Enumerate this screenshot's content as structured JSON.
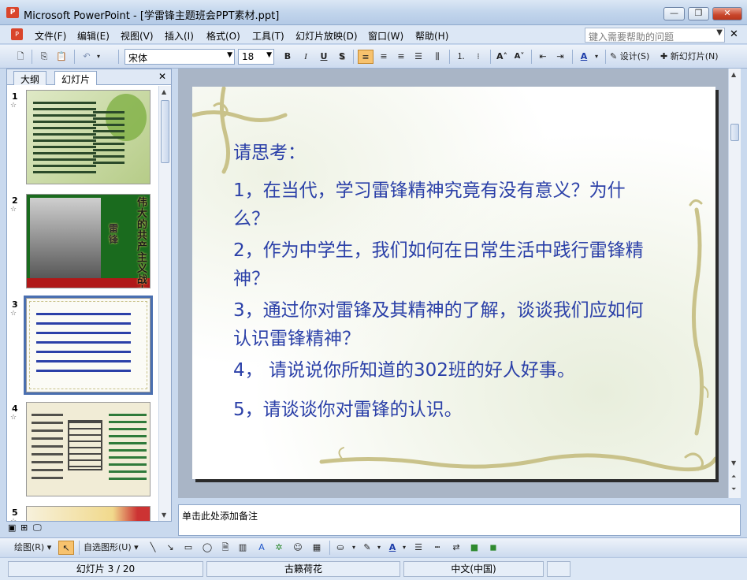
{
  "window": {
    "title": "Microsoft PowerPoint - [学雷锋主题班会PPT素材.ppt]",
    "app_icon": "P"
  },
  "menubar": {
    "items": [
      "文件(F)",
      "编辑(E)",
      "视图(V)",
      "插入(I)",
      "格式(O)",
      "工具(T)",
      "幻灯片放映(D)",
      "窗口(W)",
      "帮助(H)"
    ],
    "help_placeholder": "键入需要帮助的问题"
  },
  "toolbar": {
    "font_name": "宋体",
    "font_size": "18",
    "bold": "B",
    "italic": "I",
    "underline": "U",
    "shadow": "S",
    "design_label": "设计(S)",
    "new_slide_label": "新幻灯片(N)"
  },
  "outline_pane": {
    "tabs": [
      "大纲",
      "幻灯片"
    ],
    "selected_tab": "幻灯片",
    "slides": [
      {
        "num": "1"
      },
      {
        "num": "2",
        "caption": "伟大的共产主义战士",
        "subcaption": "雷锋"
      },
      {
        "num": "3"
      },
      {
        "num": "4"
      },
      {
        "num": "5"
      }
    ]
  },
  "slide": {
    "lines": [
      "请思考：",
      "1，在当代，学习雷锋精神究竟有没有意义？为什么？",
      "2，作为中学生，我们如何在日常生活中践行雷锋精神？",
      "3，通过你对雷锋及其精神的了解，谈谈我们应如何认识雷锋精神？",
      "4， 请说说你所知道的302班的好人好事。",
      "5，请谈谈你对雷锋的认识。"
    ],
    "text_color": "#2b40a8",
    "frame_color": "#c9c28a"
  },
  "notes": {
    "placeholder": "单击此处添加备注"
  },
  "drawbar": {
    "draw_label": "绘图(R)",
    "autoshape_label": "自选图形(U)"
  },
  "statusbar": {
    "slide_position": "幻灯片 3 / 20",
    "design_name": "古籁荷花",
    "language": "中文(中国)"
  }
}
